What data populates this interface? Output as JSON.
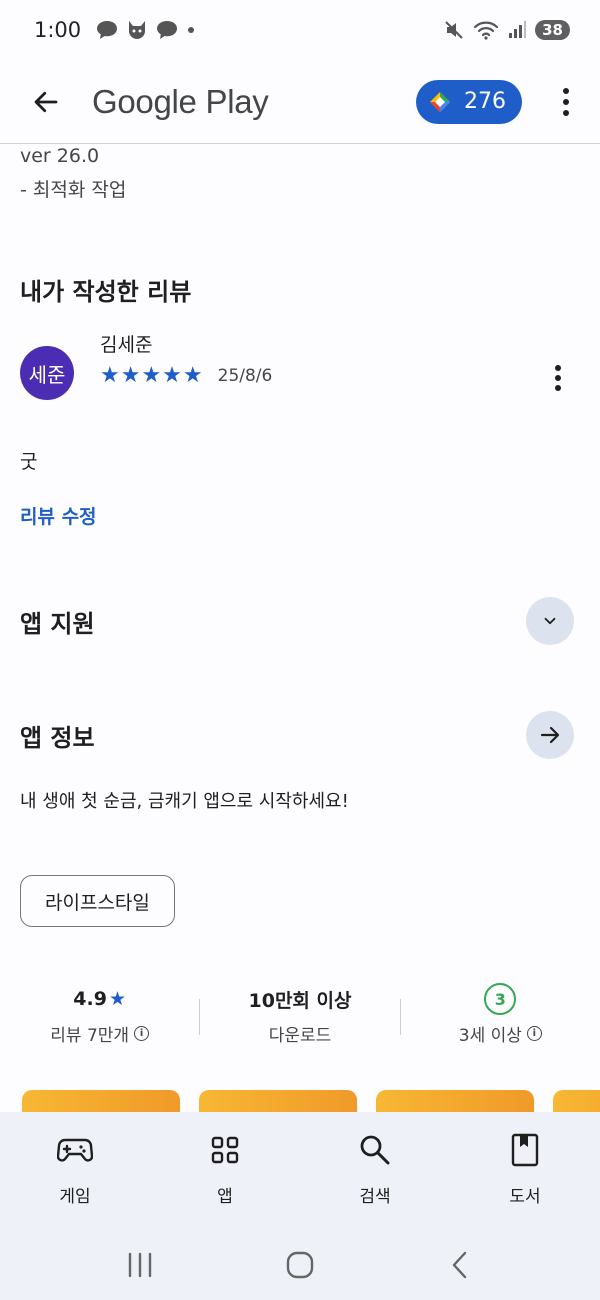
{
  "status_bar": {
    "time": "1:00",
    "battery": "38"
  },
  "app_bar": {
    "brand": "Google Play",
    "points": "276"
  },
  "whats_new": {
    "version": "ver 26.0",
    "note": "- 최적화 작업"
  },
  "my_review": {
    "title": "내가 작성한 리뷰",
    "avatar_text": "세준",
    "reviewer": "김세준",
    "stars": "★★★★★",
    "rating": 5,
    "date": "25/8/6",
    "body": "굿",
    "edit_label": "리뷰 수정"
  },
  "app_support": {
    "title": "앱 지원"
  },
  "app_info": {
    "title": "앱 정보",
    "description": "내 생애 첫 순금, 금캐기 앱으로 시작하세요!",
    "category_chip": "라이프스타일"
  },
  "stats": [
    {
      "value": "4.9",
      "label": "리뷰 7만개"
    },
    {
      "value": "10만회 이상",
      "label": "다운로드"
    },
    {
      "value": "3",
      "label": "3세 이상"
    }
  ],
  "bottom_nav": [
    {
      "label": "게임",
      "icon": "gamepad-icon"
    },
    {
      "label": "앱",
      "icon": "apps-grid-icon"
    },
    {
      "label": "검색",
      "icon": "search-icon"
    },
    {
      "label": "도서",
      "icon": "book-icon"
    }
  ],
  "colors": {
    "accent": "#1f5ec8",
    "avatar": "#4b2db3",
    "age_green": "#34a853",
    "promo": "#f7b733"
  }
}
